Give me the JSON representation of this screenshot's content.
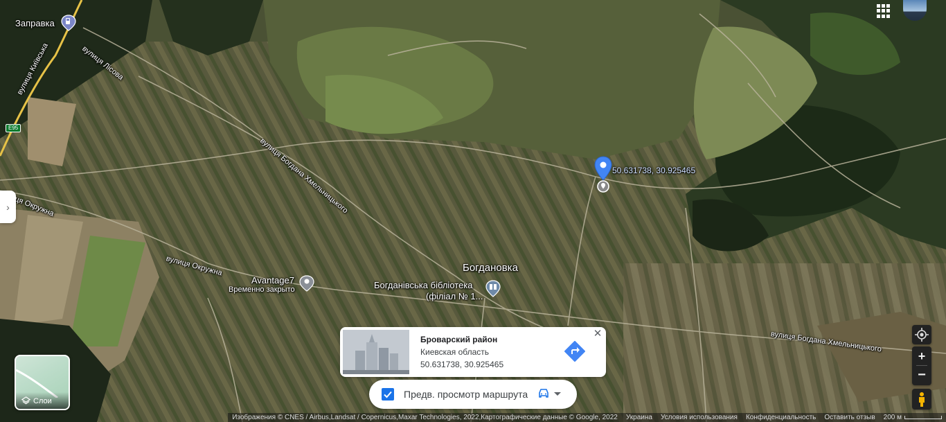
{
  "map": {
    "place_labels": {
      "gas": "Заправка",
      "village": "Богдановка",
      "avantage": "Avantage7",
      "avantage_status": "Временно закрыто",
      "library_line1": "Богданівська бібліотека",
      "library_line2": "(філіал № 1..."
    },
    "road_labels": {
      "kyivska": "вулиця Київська",
      "lisova": "вулиця Лісова",
      "e95": "E95",
      "okruzhna_1": "вулиця Окружна",
      "okruzhna_2": "вулиця Окружна",
      "khmelnytskoho_1": "вулиця Богдана Хмельницького",
      "khmelnytskoho_2": "вулиця Богдана Хмельницького"
    },
    "pin_coordinates": "50.631738, 30.925465"
  },
  "layers": {
    "label": "Слои"
  },
  "info_card": {
    "title": "Броварский район",
    "subtitle": "Киевская область",
    "coords": "50.631738, 30.925465"
  },
  "route_preview": {
    "label": "Предв. просмотр маршрута",
    "checked": true
  },
  "footer": {
    "imagery": "Изображения © CNES / Airbus,Landsat / Copernicus,Maxar Technologies, 2022,Картографические данные © Google, 2022",
    "country": "Украина",
    "terms": "Условия использования",
    "privacy": "Конфиденциальность",
    "feedback": "Оставить отзыв",
    "scale": "200 м"
  },
  "colors": {
    "accent": "#1a73e8",
    "pin": "#4285f4"
  }
}
